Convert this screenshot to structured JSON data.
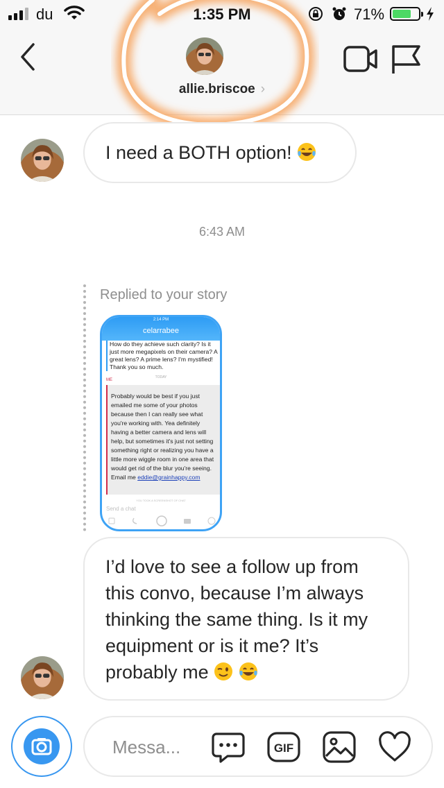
{
  "status_bar": {
    "carrier": "du",
    "time": "1:35 PM",
    "battery_percent": "71%",
    "battery_level": 0.71,
    "icons": [
      "signal-icon",
      "wifi-icon",
      "rotation-lock-icon",
      "alarm-icon",
      "battery-icon",
      "charging-bolt-icon"
    ]
  },
  "header": {
    "username": "allie.briscoe",
    "chevron": "›",
    "icons": [
      "back-chevron-icon",
      "video-call-icon",
      "flag-icon"
    ],
    "highlight_color": "#f7a35c"
  },
  "messages": [
    {
      "type": "received",
      "text": "I need a BOTH option!",
      "emoji": [
        "tears-of-joy-emoji"
      ]
    },
    {
      "type": "timestamp",
      "text": "6:43 AM"
    },
    {
      "type": "story_reply",
      "label": "Replied to your story",
      "story": {
        "status_time": "2:14 PM",
        "title": "celarrabee",
        "question": "How do they achieve such clarity? Is it just more megapixels on their camera? A great lens? A prime lens? I'm mystified! Thank you so much.",
        "today_label": "TODAY",
        "me_label": "ME",
        "reply": "Probably would be best if you just emailed me some of your photos because then I can really see what you're working with. Yea definitely having a better camera and lens will help, but sometimes it's just not setting something right or realizing you have a little more wiggle room in one area that would get rid of the blur you're seeing. Email me",
        "email": "eddie@grainhappy.com",
        "footer": "YOU TOOK A SCREENSHOT OF CHAT",
        "input_placeholder": "Send a chat"
      }
    },
    {
      "type": "received",
      "text": "I’d love to see a follow up from this convo, because I’m always thinking the same thing. Is it my equipment or is it me? It’s probably me",
      "emoji": [
        "winking-face-emoji",
        "tears-of-joy-emoji"
      ]
    }
  ],
  "composer": {
    "placeholder": "Messa...",
    "gif_label": "GIF",
    "icons": [
      "camera-icon",
      "more-options-icon",
      "gif-icon",
      "gallery-icon",
      "heart-icon"
    ],
    "accent": "#3897f0"
  }
}
